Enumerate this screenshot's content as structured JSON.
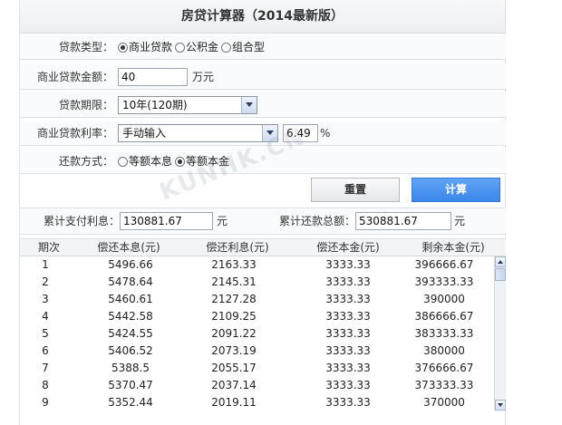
{
  "title": "房贷计算器（2014最新版）",
  "loan_type": {
    "label": "贷款类型：",
    "options": [
      {
        "text": "商业贷款",
        "selected": true
      },
      {
        "text": "公积金",
        "selected": false
      },
      {
        "text": "组合型",
        "selected": false
      }
    ]
  },
  "amount": {
    "label": "商业贷款金额：",
    "value": "40",
    "unit": "万元"
  },
  "term": {
    "label": "贷款期限：",
    "selected": "10年(120期)"
  },
  "rate": {
    "label": "商业贷款利率：",
    "mode": "手动输入",
    "value": "6.49",
    "unit": "%"
  },
  "repay": {
    "label": "还款方式：",
    "options": [
      {
        "text": "等额本息",
        "selected": false
      },
      {
        "text": "等额本金",
        "selected": true
      }
    ]
  },
  "buttons": {
    "reset": "重置",
    "calc": "计算"
  },
  "totals": {
    "interest_label": "累计支付利息：",
    "interest_value": "130881.67",
    "interest_unit": "元",
    "total_label": "累计还款总额：",
    "total_value": "530881.67",
    "total_unit": "元"
  },
  "table": {
    "headers": [
      "期次",
      "偿还本息(元)",
      "偿还利息(元)",
      "偿还本金(元)",
      "剩余本金(元)"
    ],
    "rows": [
      [
        "1",
        "5496.66",
        "2163.33",
        "3333.33",
        "396666.67"
      ],
      [
        "2",
        "5478.64",
        "2145.31",
        "3333.33",
        "393333.33"
      ],
      [
        "3",
        "5460.61",
        "2127.28",
        "3333.33",
        "390000"
      ],
      [
        "4",
        "5442.58",
        "2109.25",
        "3333.33",
        "386666.67"
      ],
      [
        "5",
        "5424.55",
        "2091.22",
        "3333.33",
        "383333.33"
      ],
      [
        "6",
        "5406.52",
        "2073.19",
        "3333.33",
        "380000"
      ],
      [
        "7",
        "5388.5",
        "2055.17",
        "3333.33",
        "376666.67"
      ],
      [
        "8",
        "5370.47",
        "2037.14",
        "3333.33",
        "373333.33"
      ],
      [
        "9",
        "5352.44",
        "2019.11",
        "3333.33",
        "370000"
      ]
    ]
  },
  "watermark": "KUNHK.CN"
}
